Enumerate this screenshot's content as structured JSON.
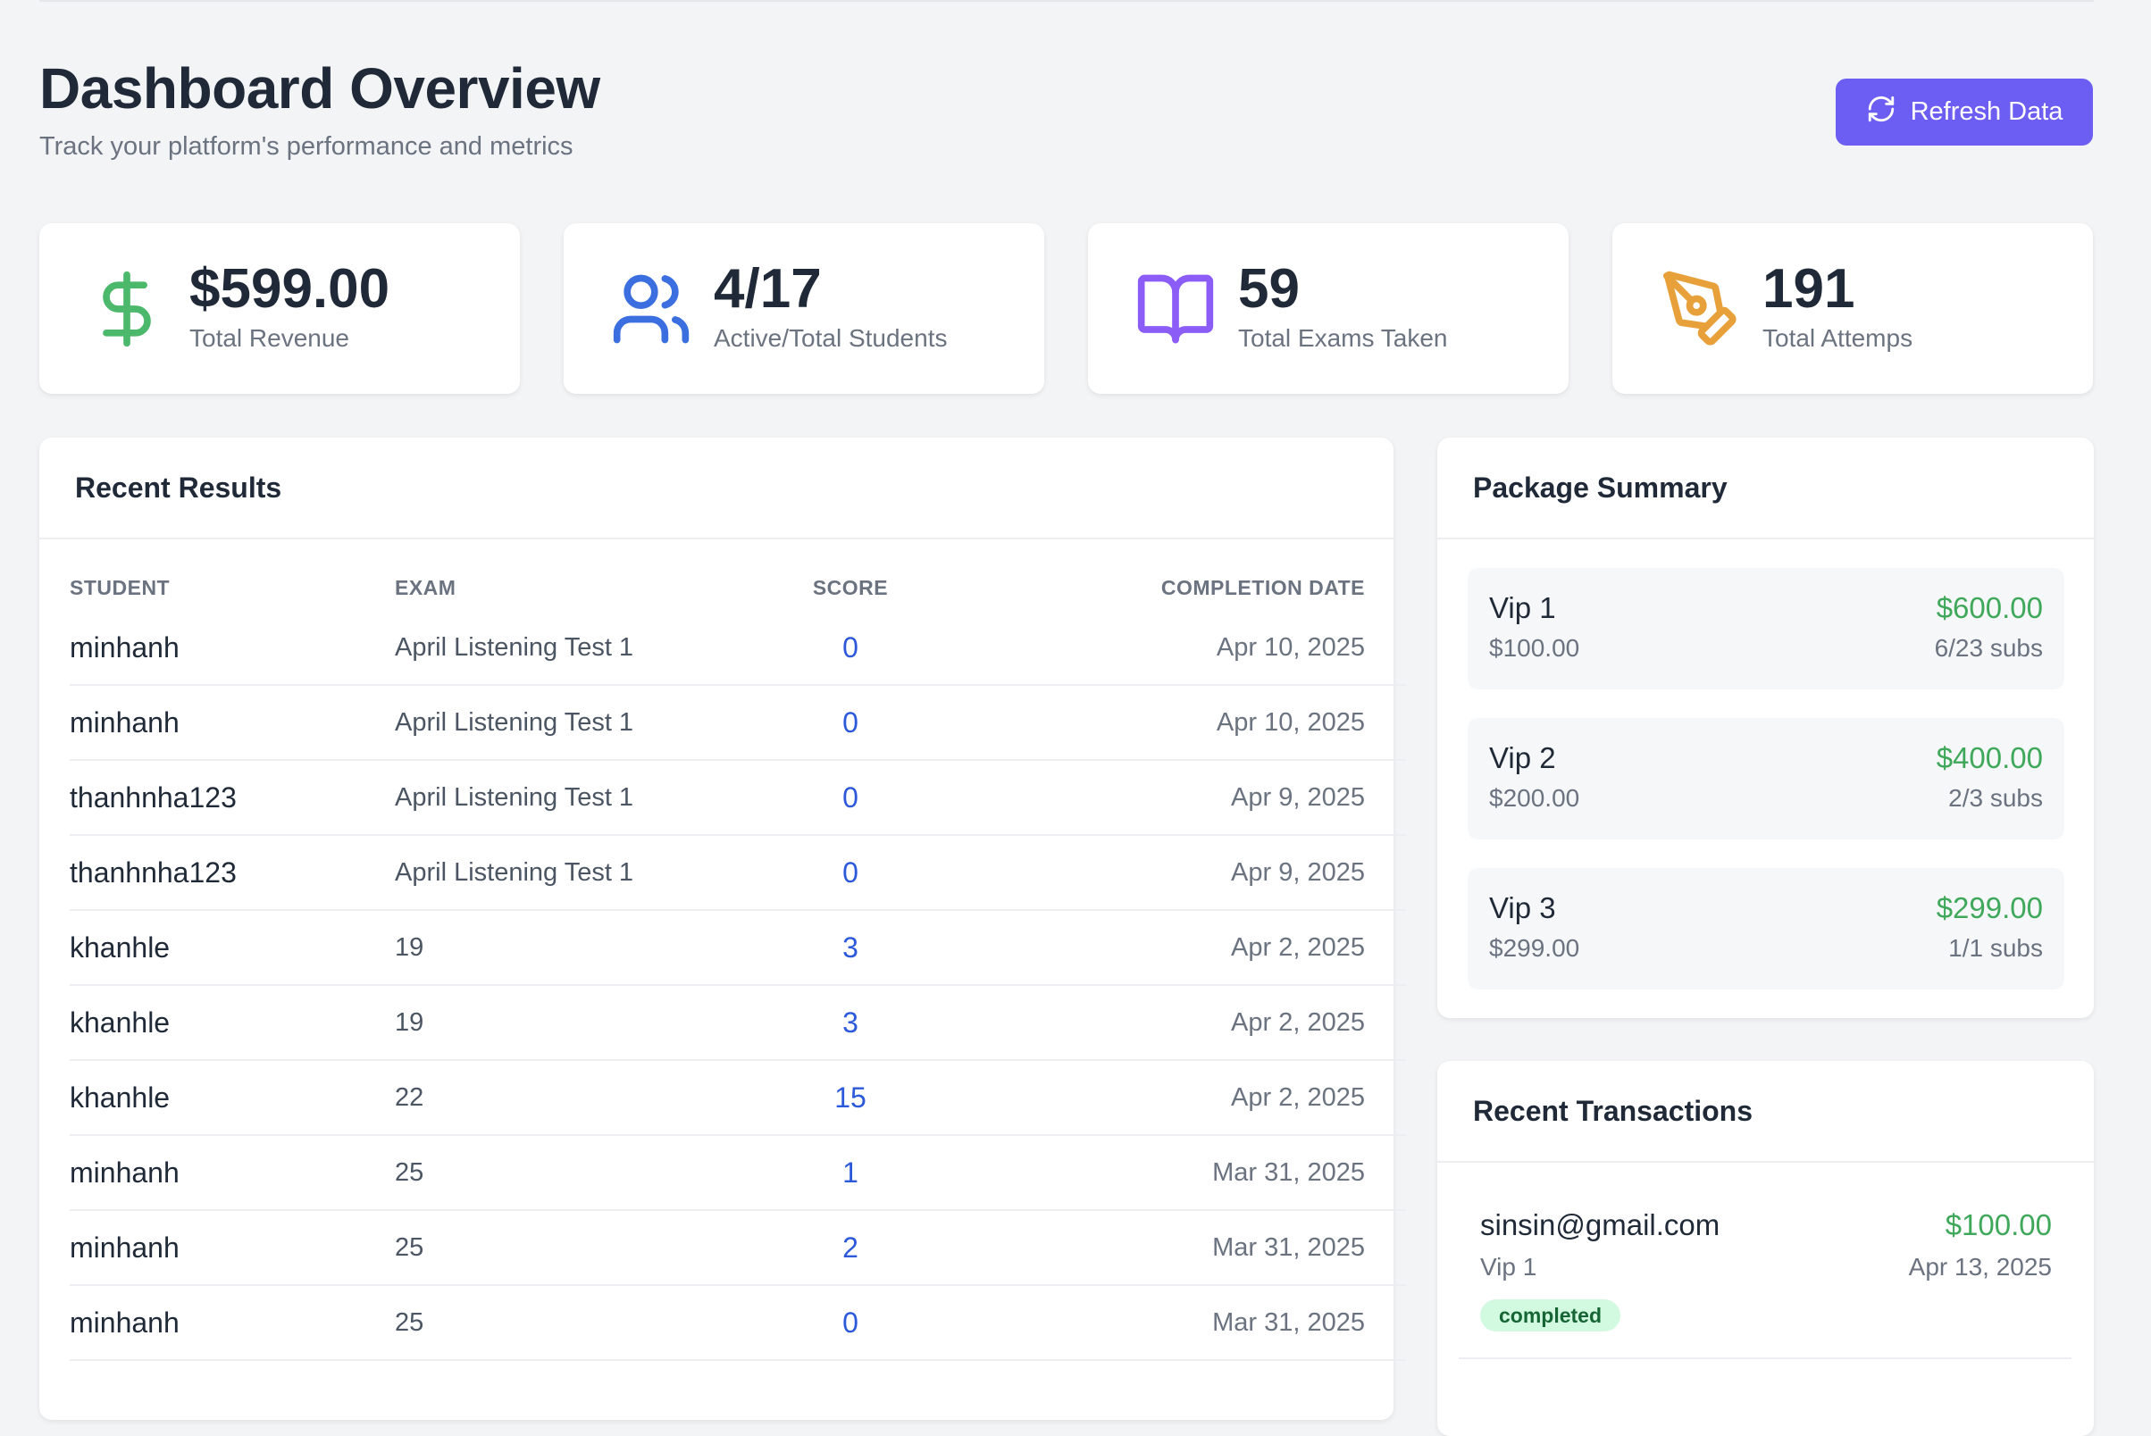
{
  "header": {
    "title": "Dashboard Overview",
    "subtitle": "Track your platform's performance and metrics",
    "refresh_label": "Refresh Data"
  },
  "stats": [
    {
      "value": "$599.00",
      "label": "Total Revenue",
      "icon": "dollar-icon",
      "color": "#4cb86b"
    },
    {
      "value": "4/17",
      "label": "Active/Total Students",
      "icon": "users-icon",
      "color": "#3b6fe0"
    },
    {
      "value": "59",
      "label": "Total Exams Taken",
      "icon": "book-open-icon",
      "color": "#8b5cf6"
    },
    {
      "value": "191",
      "label": "Total Attemps",
      "icon": "pen-tool-icon",
      "color": "#e8a13a"
    }
  ],
  "results": {
    "title": "Recent Results",
    "columns": [
      "STUDENT",
      "EXAM",
      "SCORE",
      "COMPLETION DATE"
    ],
    "rows": [
      {
        "student": "minhanh",
        "exam": "April Listening Test 1",
        "score": "0",
        "date": "Apr 10, 2025"
      },
      {
        "student": "minhanh",
        "exam": "April Listening Test 1",
        "score": "0",
        "date": "Apr 10, 2025"
      },
      {
        "student": "thanhnha123",
        "exam": "April Listening Test 1",
        "score": "0",
        "date": "Apr 9, 2025"
      },
      {
        "student": "thanhnha123",
        "exam": "April Listening Test 1",
        "score": "0",
        "date": "Apr 9, 2025"
      },
      {
        "student": "khanhle",
        "exam": "19",
        "score": "3",
        "date": "Apr 2, 2025"
      },
      {
        "student": "khanhle",
        "exam": "19",
        "score": "3",
        "date": "Apr 2, 2025"
      },
      {
        "student": "khanhle",
        "exam": "22",
        "score": "15",
        "date": "Apr 2, 2025"
      },
      {
        "student": "minhanh",
        "exam": "25",
        "score": "1",
        "date": "Mar 31, 2025"
      },
      {
        "student": "minhanh",
        "exam": "25",
        "score": "2",
        "date": "Mar 31, 2025"
      },
      {
        "student": "minhanh",
        "exam": "25",
        "score": "0",
        "date": "Mar 31, 2025"
      }
    ]
  },
  "packages": {
    "title": "Package Summary",
    "items": [
      {
        "name": "Vip 1",
        "price": "$100.00",
        "total": "$600.00",
        "subs": "6/23 subs"
      },
      {
        "name": "Vip 2",
        "price": "$200.00",
        "total": "$400.00",
        "subs": "2/3 subs"
      },
      {
        "name": "Vip 3",
        "price": "$299.00",
        "total": "$299.00",
        "subs": "1/1 subs"
      }
    ]
  },
  "transactions": {
    "title": "Recent Transactions",
    "items": [
      {
        "email": "sinsin@gmail.com",
        "package": "Vip 1",
        "amount": "$100.00",
        "date": "Apr 13, 2025",
        "status": "completed"
      }
    ]
  },
  "colors": {
    "accent": "#6d5ef3",
    "positive": "#3fa85a",
    "score": "#2b59d9"
  }
}
